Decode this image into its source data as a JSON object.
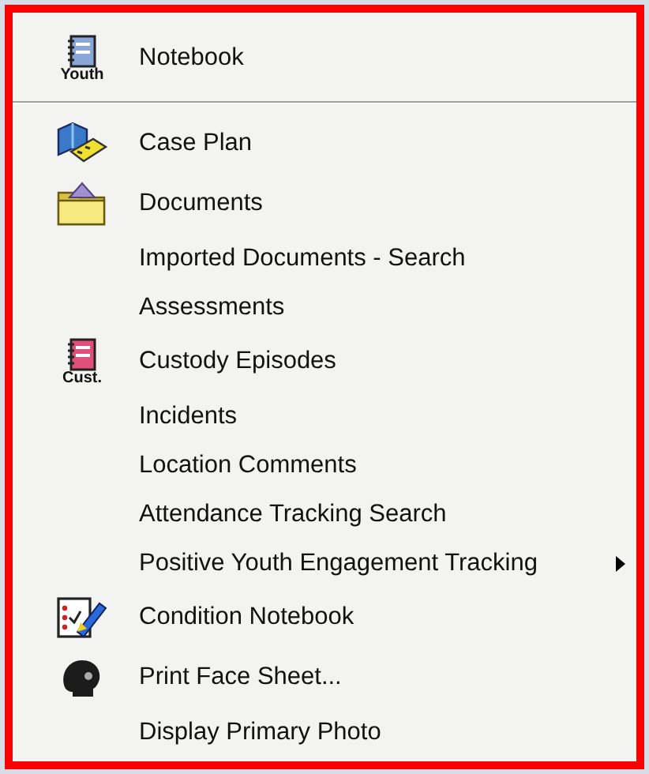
{
  "menu": {
    "items": [
      {
        "kind": "notebook",
        "label": "Notebook",
        "color": "#8aa6d8",
        "icon_caption": "Youth",
        "has_submenu": false
      },
      {
        "kind": "separator"
      },
      {
        "kind": "case-plan",
        "label": "Case Plan",
        "has_submenu": false
      },
      {
        "kind": "folder",
        "label": "Documents",
        "has_submenu": false
      },
      {
        "kind": "plain",
        "label": "Imported Documents - Search",
        "has_submenu": false
      },
      {
        "kind": "plain",
        "label": "Assessments",
        "has_submenu": false
      },
      {
        "kind": "notebook",
        "label": "Custody Episodes",
        "color": "#e0507a",
        "icon_caption": "Cust.",
        "has_submenu": false
      },
      {
        "kind": "plain",
        "label": "Incidents",
        "has_submenu": false
      },
      {
        "kind": "plain",
        "label": "Location Comments",
        "has_submenu": false
      },
      {
        "kind": "plain",
        "label": "Attendance Tracking Search",
        "has_submenu": false
      },
      {
        "kind": "plain",
        "label": "Positive Youth Engagement Tracking",
        "has_submenu": true
      },
      {
        "kind": "checklist",
        "label": "Condition Notebook",
        "has_submenu": false
      },
      {
        "kind": "face",
        "label": "Print Face Sheet...",
        "has_submenu": false
      },
      {
        "kind": "plain",
        "label": "Display Primary Photo",
        "has_submenu": false
      }
    ]
  }
}
